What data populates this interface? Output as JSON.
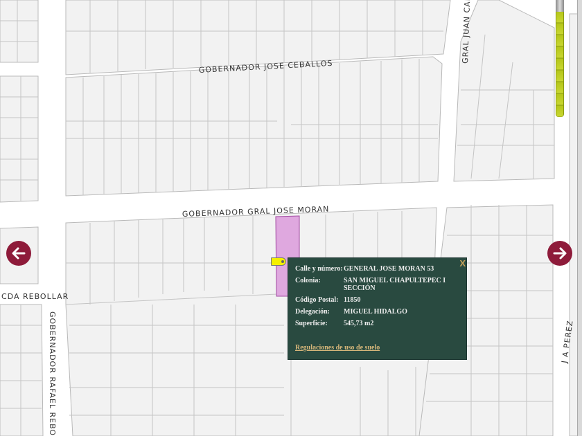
{
  "streets": {
    "top": "GOBERNADOR JOSE CEBALLOS",
    "middle": "GOBERNADOR GRAL JOSE MORAN",
    "left_short": "CDA REBOLLAR",
    "left_vertical": "GOBERNADOR RAFAEL REBOL",
    "top_right": "GRAL JUAN CAN",
    "right": "J A PEREZ"
  },
  "popup": {
    "close": "X",
    "rows": [
      {
        "label": "Calle y número:",
        "value": "GENERAL JOSE MORAN 53"
      },
      {
        "label": "Colonia:",
        "value": "SAN MIGUEL CHAPULTEPEC I SECCIÓN"
      },
      {
        "label": "Código Postal:",
        "value": "11850"
      },
      {
        "label": "Delegación:",
        "value": "MIGUEL HIDALGO"
      },
      {
        "label": "Superficie:",
        "value": "545,73 m2"
      }
    ],
    "link": "Regulaciones de uso de suelo"
  },
  "colors": {
    "highlight": "#dfa8df",
    "popup_bg": "#294a40",
    "arrow": "#8e1b3a"
  },
  "zoom_level_fraction": 0.9
}
